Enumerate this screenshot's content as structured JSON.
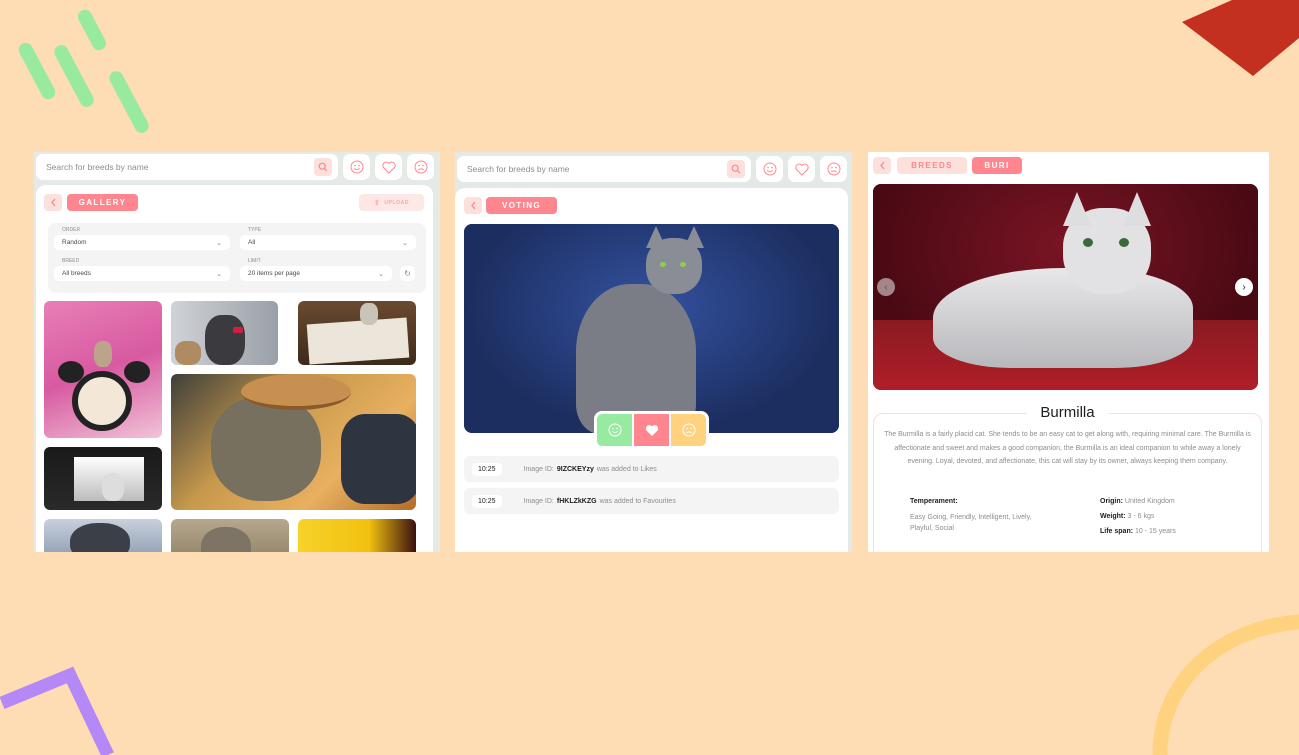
{
  "colors": {
    "background": "#FFDDB4",
    "accent": "#FF868E",
    "accent_light": "#FBE0DC",
    "green": "#97EAA0",
    "yellow": "#FFD280",
    "red_deco": "#C4301F",
    "purple_deco": "#B488F7"
  },
  "search": {
    "placeholder": "Search for breeds by name"
  },
  "icons": [
    "search-icon",
    "smile-icon",
    "heart-icon",
    "sad-icon",
    "back-icon",
    "upload-icon",
    "refresh-icon",
    "chevron-left-icon",
    "chevron-right-icon"
  ],
  "gallery": {
    "tag": "GALLERY",
    "upload_label": "UPLOAD",
    "filters": {
      "order_label": "ORDER",
      "order_value": "Random",
      "type_label": "TYPE",
      "type_value": "All",
      "breed_label": "BREED",
      "breed_value": "All breeds",
      "limit_label": "LIMIT",
      "limit_value": "20 items per page"
    }
  },
  "voting": {
    "tag": "VOTING",
    "logs": [
      {
        "time": "10:25",
        "prefix": "Image ID:",
        "id": "9IZCKEYzy",
        "suffix": "was added to Likes"
      },
      {
        "time": "10:25",
        "prefix": "Image ID:",
        "id": "fHKLZkKZG",
        "suffix": "was added to Favourites"
      }
    ]
  },
  "breeds": {
    "tag": "BREEDS",
    "selected_tag": "BURI",
    "name": "Burmilla",
    "description": "The Burmilla is a fairly placid cat. She tends to be an easy cat to get along with, requiring minimal care. The Burmilla is affectionate and sweet and makes a good companion, the Burmilla is an ideal companion to while away a lonely evening. Loyal, devoted, and affectionate, this cat will stay by its owner, always keeping them company.",
    "temperament_label": "Temperament:",
    "temperament_value": "Easy Going, Friendly, Intelligent, Lively, Playful, Social",
    "origin_label": "Origin:",
    "origin_value": "United Kingdom",
    "weight_label": "Weight:",
    "weight_value": "3 - 6 kgs",
    "lifespan_label": "Life span:",
    "lifespan_value": "10 - 15 years"
  }
}
